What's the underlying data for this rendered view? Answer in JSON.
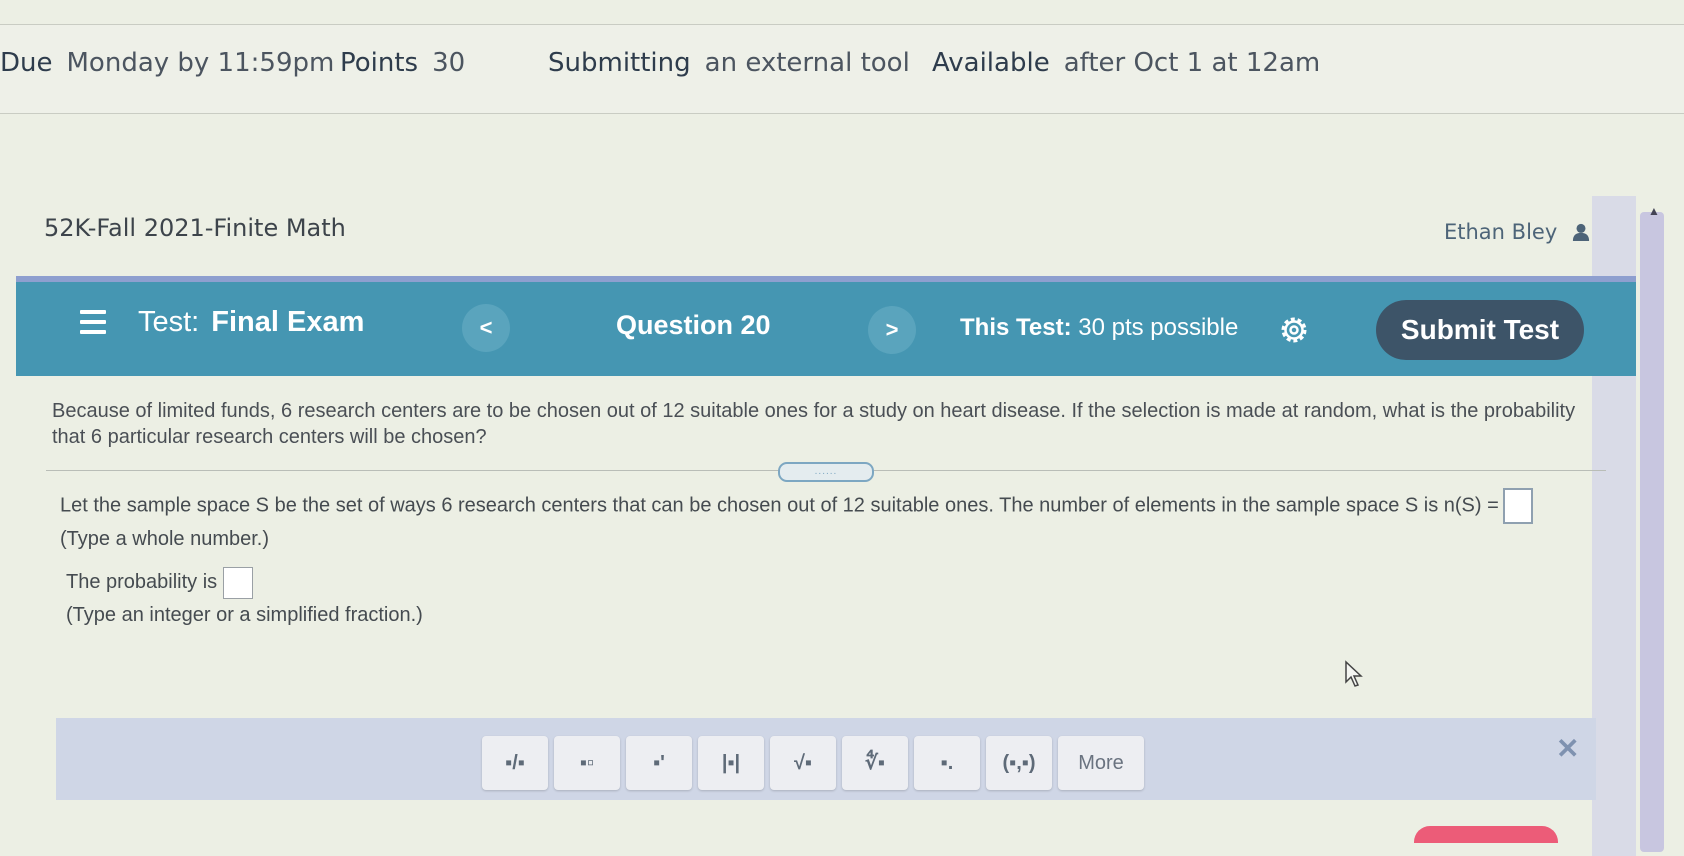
{
  "assignment_info": {
    "due_label": "Due",
    "due_value": "Monday by 11:59pm",
    "points_label": "Points",
    "points_value": "30",
    "submitting_label": "Submitting",
    "submitting_value": "an external tool",
    "available_label": "Available",
    "available_value": "after Oct 1 at 12am"
  },
  "course": {
    "title": "52K-Fall 2021-Finite Math"
  },
  "user": {
    "name": "Ethan Bley",
    "icon": "user-icon"
  },
  "header": {
    "menu_icon": "hamburger-menu-icon",
    "test_label": "Test:",
    "test_name": "Final Exam",
    "prev_label": "<",
    "question_label": "Question 20",
    "next_label": ">",
    "points_label": "This Test:",
    "points_value": "30 pts possible",
    "settings_icon": "gear-icon",
    "submit_label": "Submit Test",
    "colors": {
      "bar": "#4596b2",
      "submit": "#3d5468"
    }
  },
  "question": {
    "text": "Because of limited funds, 6 research centers are to be chosen out of 12 suitable ones for a study on heart disease. If the selection is made at random, what is the probability that 6 particular research centers will be chosen?",
    "handle_label": "......",
    "part1_text": "Let the sample space S be the set of ways 6 research centers that can be chosen out of 12 suitable ones. The number of elements in the sample space S is n(S) =",
    "part1_hint": "(Type a whole number.)",
    "part1_value": "",
    "part2_text": "The probability is",
    "part2_hint": "(Type an integer or a simplified fraction.)",
    "part2_value": ""
  },
  "toolbar": {
    "tools": [
      {
        "name": "fraction-tool",
        "glyph": "▪/▪"
      },
      {
        "name": "mixed-number-tool",
        "glyph": "▪▫"
      },
      {
        "name": "exponent-tool",
        "glyph": "▪'"
      },
      {
        "name": "absolute-value-tool",
        "glyph": "|▪|"
      },
      {
        "name": "square-root-tool",
        "glyph": "√▪"
      },
      {
        "name": "nth-root-tool",
        "glyph": "∜▪"
      },
      {
        "name": "subscript-tool",
        "glyph": "▪."
      },
      {
        "name": "ordered-pair-tool",
        "glyph": "(▪,▪)"
      }
    ],
    "more_label": "More",
    "close_icon": "close-icon",
    "close_glyph": "✕"
  }
}
